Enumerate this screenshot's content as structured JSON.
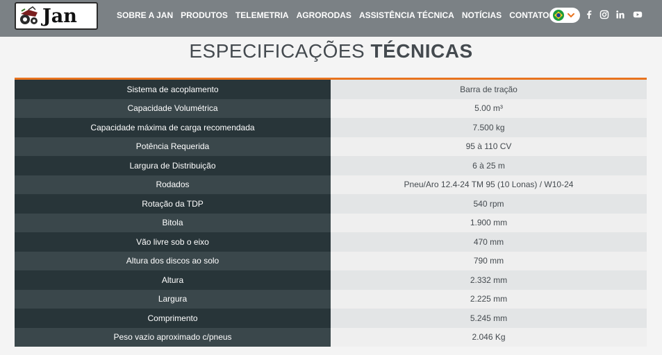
{
  "header": {
    "logo_text": "Jan",
    "nav": [
      "SOBRE A JAN",
      "PRODUTOS",
      "TELEMETRIA",
      "AGRORODAS",
      "ASSISTÊNCIA TÉCNICA",
      "NOTÍCIAS",
      "CONTATO"
    ],
    "language_icon": "brazil-flag-icon",
    "social_icons": [
      "facebook-icon",
      "instagram-icon",
      "linkedin-icon",
      "youtube-icon"
    ]
  },
  "section": {
    "title_light": "ESPECIFICAÇÕES",
    "title_bold": "TÉCNICAS"
  },
  "specs": [
    {
      "label": "Sistema de acoplamento",
      "value": "Barra de tração"
    },
    {
      "label": "Capacidade Volumétrica",
      "value": "5.00 m³"
    },
    {
      "label": "Capacidade máxima de carga recomendada",
      "value": "7.500 kg"
    },
    {
      "label": "Potência Requerida",
      "value": "95 à 110 CV"
    },
    {
      "label": "Largura de Distribuição",
      "value": "6 à 25 m"
    },
    {
      "label": "Rodados",
      "value": "Pneu/Aro 12.4-24 TM 95 (10 Lonas) / W10-24"
    },
    {
      "label": "Rotação da TDP",
      "value": "540 rpm"
    },
    {
      "label": "Bitola",
      "value": "1.900 mm"
    },
    {
      "label": "Vão livre sob o eixo",
      "value": "470 mm"
    },
    {
      "label": "Altura dos discos ao solo",
      "value": "790 mm"
    },
    {
      "label": "Altura",
      "value": "2.332 mm"
    },
    {
      "label": "Largura",
      "value": "2.225 mm"
    },
    {
      "label": "Comprimento",
      "value": "5.245 mm"
    },
    {
      "label": "Peso vazio aproximado c/pneus",
      "value": "2.046 Kg"
    }
  ],
  "colors": {
    "header_bg": "#7b8185",
    "accent_orange": "#e8731e",
    "label_dark": "#283539",
    "label_alt": "#3a474b"
  }
}
